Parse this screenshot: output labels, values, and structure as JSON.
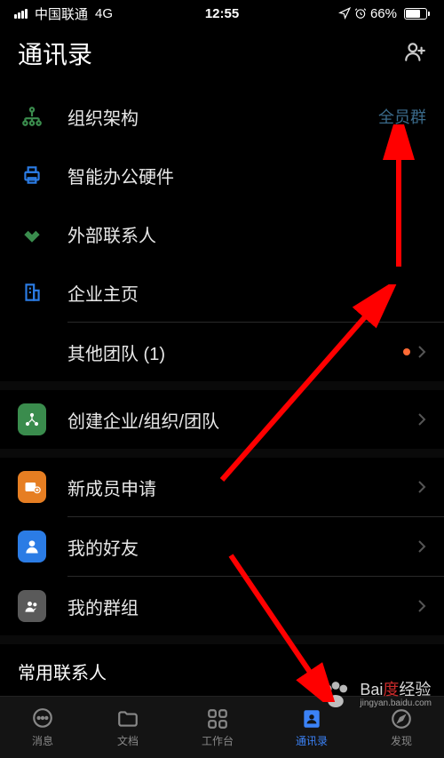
{
  "status": {
    "carrier": "中国联通",
    "network": "4G",
    "time": "12:55",
    "battery_percent": "66%"
  },
  "header": {
    "title": "通讯录"
  },
  "menu": {
    "org_structure": "组织架构",
    "full_group_link": "全员群",
    "smart_hardware": "智能办公硬件",
    "external_contacts": "外部联系人",
    "enterprise_home": "企业主页",
    "other_teams": "其他团队 (1)",
    "create_org": "创建企业/组织/团队",
    "new_member_apply": "新成员申请",
    "my_friends": "我的好友",
    "my_groups": "我的群组",
    "frequent_contacts": "常用联系人"
  },
  "tabs": {
    "messages": "消息",
    "docs": "文档",
    "workspace": "工作台",
    "contacts": "通讯录",
    "discover": "发现"
  },
  "watermark": {
    "brand_left": "Bai",
    "brand_right": "经验",
    "url": "jingyan.baidu.com"
  }
}
